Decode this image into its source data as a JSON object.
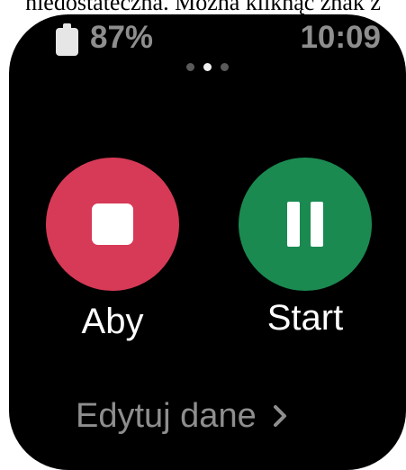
{
  "caption": "niedostateczna. Można kliknąć znak z",
  "status": {
    "battery_percent": "87%",
    "battery_icon": "battery-icon",
    "time": "10:09"
  },
  "pager": {
    "pages": 3,
    "active_index": 1
  },
  "actions": {
    "stop": {
      "label": "Aby",
      "icon": "stop-icon",
      "color": "#d63a56"
    },
    "pause": {
      "label": "Start",
      "icon": "pause-icon",
      "color": "#1a8a51"
    }
  },
  "edit": {
    "label": "Edytuj dane",
    "icon": "chevron-right-icon"
  }
}
